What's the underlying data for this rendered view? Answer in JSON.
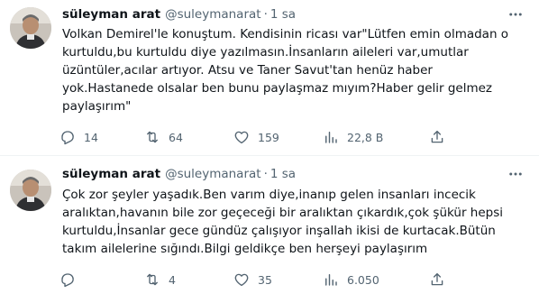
{
  "tweets": [
    {
      "author_name": "süleyman arat",
      "handle": "@suleymanarat",
      "separator": "·",
      "time": "1 sa",
      "lines": [
        "Volkan Demirel'le konuştum. Kendisinin ricası var\"Lütfen emin olmadan o",
        "kurtuldu,bu kurtuldu diye yazılmasın.İnsanların aileleri var,umutlar",
        "üzüntüler,acılar artıyor. Atsu ve Taner Savut'tan henüz haber",
        "yok.Hastanede olsalar ben bunu paylaşmaz mıyım?Haber gelir gelmez",
        "paylaşırım\""
      ],
      "replies": "14",
      "retweets": "64",
      "likes": "159",
      "views": "22,8 B"
    },
    {
      "author_name": "süleyman arat",
      "handle": "@suleymanarat",
      "separator": "·",
      "time": "1 sa",
      "lines": [
        "Çok zor şeyler yaşadık.Ben varım diye,inanıp gelen insanları incecik",
        "aralıktan,havanın bile zor  geçeceği bir aralıktan çıkardık,çok şükür hepsi",
        "kurtuldu,İnsanlar gece gündüz çalışıyor inşallah ikisi de kurtacak.Bütün",
        "takım ailelerine sığındı.Bilgi geldikçe ben herşeyi paylaşırım"
      ],
      "replies": "",
      "retweets": "4",
      "likes": "35",
      "views": "6.050"
    }
  ],
  "icons": {
    "reply": "reply-icon",
    "retweet": "retweet-icon",
    "like": "heart-icon",
    "views": "views-icon",
    "share": "share-icon",
    "more": "more-icon"
  },
  "colors": {
    "text": "#0f1419",
    "secondary": "#536471",
    "divider": "#eff3f4"
  }
}
